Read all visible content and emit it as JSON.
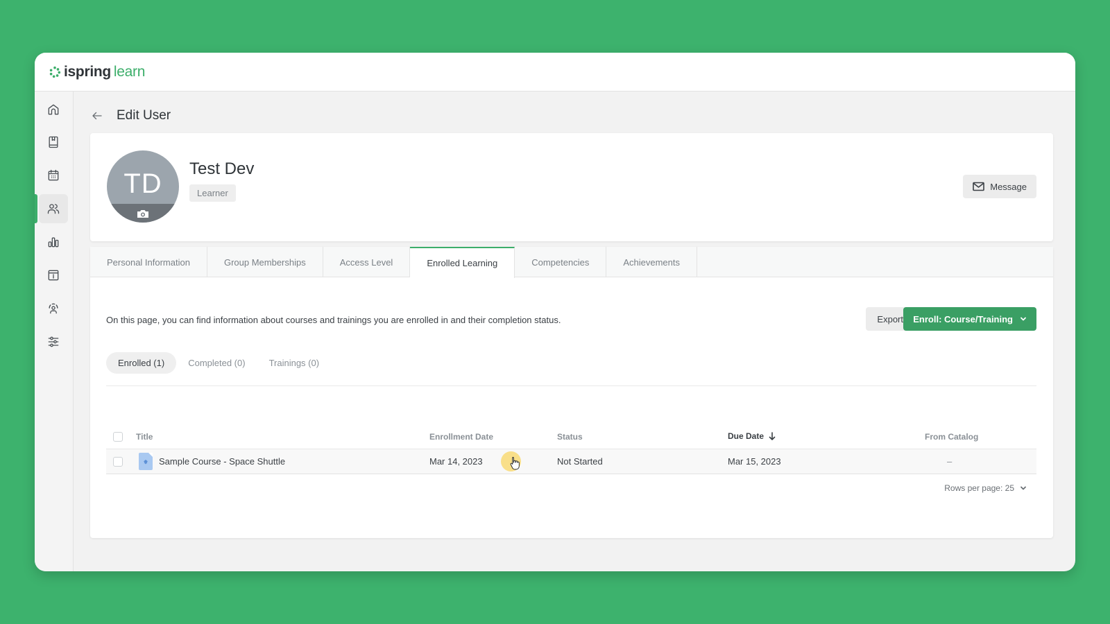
{
  "app": {
    "logo_brand": "ispring",
    "logo_product": "learn",
    "accent_color": "#3cae6a",
    "background_color": "#3db26d"
  },
  "sidebar": {
    "items": [
      {
        "name": "home",
        "icon": "home-icon",
        "active": false
      },
      {
        "name": "content",
        "icon": "book-icon",
        "active": false
      },
      {
        "name": "calendar",
        "icon": "calendar-icon",
        "active": false
      },
      {
        "name": "users",
        "icon": "users-icon",
        "active": true
      },
      {
        "name": "reports",
        "icon": "bar-chart-icon",
        "active": false
      },
      {
        "name": "info",
        "icon": "info-icon",
        "active": false
      },
      {
        "name": "support",
        "icon": "headset-icon",
        "active": false
      },
      {
        "name": "settings",
        "icon": "sliders-icon",
        "active": false
      }
    ]
  },
  "header": {
    "title": "Edit User"
  },
  "profile": {
    "initials": "TD",
    "name": "Test Dev",
    "role": "Learner",
    "message_label": "Message"
  },
  "tabs": [
    {
      "label": "Personal Information",
      "active": false
    },
    {
      "label": "Group Memberships",
      "active": false
    },
    {
      "label": "Access Level",
      "active": false
    },
    {
      "label": "Enrolled Learning",
      "active": true
    },
    {
      "label": "Competencies",
      "active": false
    },
    {
      "label": "Achievements",
      "active": false
    }
  ],
  "enrolled": {
    "description": "On this page, you can find information about courses and trainings you are enrolled in and their completion status.",
    "export_label": "Export",
    "enroll_label": "Enroll: Course/Training",
    "subtabs": [
      {
        "label": "Enrolled (1)",
        "active": true
      },
      {
        "label": "Completed (0)",
        "active": false
      },
      {
        "label": "Trainings (0)",
        "active": false
      }
    ],
    "table": {
      "columns": {
        "title": "Title",
        "enrollment_date": "Enrollment Date",
        "status": "Status",
        "due_date": "Due Date",
        "from_catalog": "From Catalog"
      },
      "sorted_by": "due_date",
      "sort_direction": "descending",
      "rows": [
        {
          "title": "Sample Course - Space Shuttle",
          "enrollment_date": "Mar 14, 2023",
          "status": "Not Started",
          "due_date": "Mar 15, 2023",
          "from_catalog": "–"
        }
      ]
    },
    "rows_per_page_label": "Rows per page: 25"
  }
}
